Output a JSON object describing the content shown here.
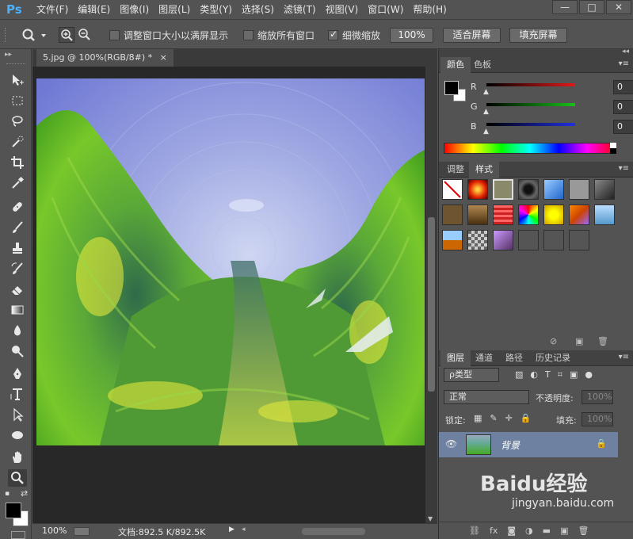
{
  "app": {
    "logo": "Ps"
  },
  "menu": [
    "文件(F)",
    "编辑(E)",
    "图像(I)",
    "图层(L)",
    "类型(Y)",
    "选择(S)",
    "滤镜(T)",
    "视图(V)",
    "窗口(W)",
    "帮助(H)"
  ],
  "window_controls": {
    "minimize": "—",
    "restore": "□",
    "close": "✕"
  },
  "options": {
    "resize_windows_label": "调整窗口大小以满屏显示",
    "resize_windows_checked": false,
    "zoom_all_label": "缩放所有窗口",
    "zoom_all_checked": false,
    "scrubby_label": "细微缩放",
    "scrubby_checked": true,
    "percent_button": "100%",
    "fit_screen_button": "适合屏幕",
    "fill_screen_button": "填充屏幕"
  },
  "document": {
    "tab_title": "5.jpg @ 100%(RGB/8#) *",
    "tab_close": "×",
    "zoom_level": "100%",
    "doc_info": "文档:892.5 K/892.5K"
  },
  "color_panel": {
    "tabs": [
      "颜色",
      "色板"
    ],
    "active_tab": 0,
    "foreground": "#000000",
    "background": "#ffffff",
    "channels": [
      {
        "label": "R",
        "value": "0",
        "color": "#cc2222"
      },
      {
        "label": "G",
        "value": "0",
        "color": "#22aa22"
      },
      {
        "label": "B",
        "value": "0",
        "color": "#2233cc"
      }
    ]
  },
  "styles_panel": {
    "tabs": [
      "调整",
      "样式"
    ],
    "active_tab": 1,
    "styles": [
      "none",
      "red-glow",
      "outline-frame",
      "black-chrome",
      "blue-glass",
      "gray-bevel",
      "dark-gradient",
      "bronze",
      "brown-gradient",
      "red-stripes",
      "rainbow-pattern",
      "yellow-glow",
      "orange-blend",
      "sky-blue",
      "sunset",
      "silver-pattern",
      "purple-glass",
      "dark-gray",
      "dark-gray-2",
      "dark-gray-3"
    ]
  },
  "layers_panel": {
    "tabs": [
      "图层",
      "通道",
      "路径",
      "历史记录"
    ],
    "active_tab": 0,
    "filter_label": "ρ类型",
    "blend_mode": "正常",
    "opacity_label": "不透明度:",
    "opacity_value": "100%",
    "lock_label": "锁定:",
    "fill_label": "填充:",
    "fill_value": "100%",
    "layers": [
      {
        "name": "背景",
        "visible": true,
        "locked": true
      }
    ]
  },
  "watermark": {
    "brand": "Baidu经验",
    "url": "jingyan.baidu.com"
  }
}
